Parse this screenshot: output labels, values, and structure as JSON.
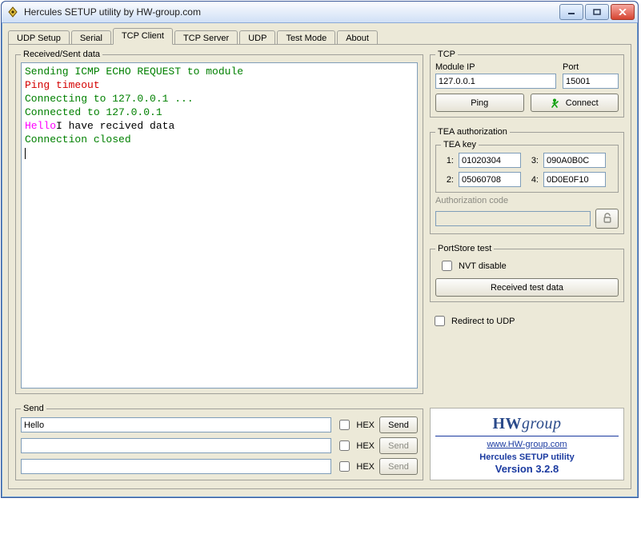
{
  "window": {
    "title": "Hercules SETUP utility by HW-group.com"
  },
  "tabs": {
    "items": [
      "UDP Setup",
      "Serial",
      "TCP Client",
      "TCP Server",
      "UDP",
      "Test Mode",
      "About"
    ],
    "active_index": 2
  },
  "received": {
    "legend": "Received/Sent data",
    "lines": [
      {
        "cls": "t-green",
        "text": "Sending ICMP ECHO REQUEST to module"
      },
      {
        "cls": "t-red",
        "text": "Ping timeout"
      },
      {
        "cls": "t-green",
        "text": "Connecting to 127.0.0.1 ..."
      },
      {
        "cls": "t-green",
        "text": "Connected to 127.0.0.1"
      },
      {
        "spans": [
          {
            "cls": "t-pink",
            "text": "Hello"
          },
          {
            "cls": "t-black",
            "text": "I have recived data"
          }
        ]
      },
      {
        "cls": "t-green",
        "text": "Connection closed"
      }
    ]
  },
  "tcp": {
    "legend": "TCP",
    "module_ip_label": "Module IP",
    "module_ip": "127.0.0.1",
    "port_label": "Port",
    "port": "15001",
    "ping": "Ping",
    "connect": "Connect"
  },
  "tea": {
    "legend": "TEA authorization",
    "key_legend": "TEA key",
    "k1_label": "1:",
    "k1": "01020304",
    "k2_label": "2:",
    "k2": "05060708",
    "k3_label": "3:",
    "k3": "090A0B0C",
    "k4_label": "4:",
    "k4": "0D0E0F10",
    "auth_label": "Authorization code",
    "auth_code": ""
  },
  "portstore": {
    "legend": "PortStore test",
    "nvt_label": "NVT disable",
    "nvt_checked": false,
    "recv_btn": "Received test data"
  },
  "redirect": {
    "label": "Redirect to UDP",
    "checked": false
  },
  "send": {
    "legend": "Send",
    "hex_label": "HEX",
    "send_label": "Send",
    "rows": [
      {
        "value": "Hello",
        "hex": false,
        "enabled": true
      },
      {
        "value": "",
        "hex": false,
        "enabled": false
      },
      {
        "value": "",
        "hex": false,
        "enabled": false
      }
    ]
  },
  "brand": {
    "logo_a": "HW",
    "logo_b": "group",
    "url": "www.HW-group.com",
    "product": "Hercules SETUP utility",
    "version": "Version  3.2.8"
  }
}
